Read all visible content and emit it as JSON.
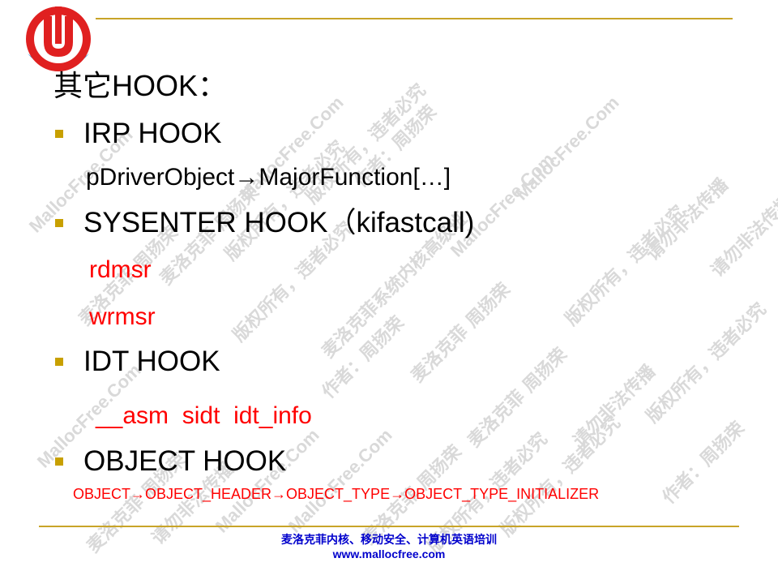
{
  "slide": {
    "heading": "其它HOOK：",
    "items": [
      {
        "kind": "bullet",
        "text": "IRP HOOK"
      },
      {
        "kind": "sub",
        "text": "pDriverObject→MajorFunction[…]"
      },
      {
        "kind": "bullet",
        "text": "SYSENTER HOOK（kifastcall)"
      },
      {
        "kind": "sub-red",
        "text": "rdmsr"
      },
      {
        "kind": "sub-red",
        "text": "wrmsr"
      },
      {
        "kind": "bullet",
        "text": "IDT HOOK"
      },
      {
        "kind": "sub-red",
        "text": "__asm  sidt  idt_info"
      },
      {
        "kind": "bullet",
        "text": "OBJECT HOOK"
      },
      {
        "kind": "small-red",
        "text": "OBJECT→OBJECT_HEADER→OBJECT_TYPE→OBJECT_TYPE_INITIALIZER"
      }
    ],
    "footer_line1": "麦洛克菲内核、移动安全、计算机英语培训",
    "footer_line2": "www.mallocfree.com"
  },
  "watermark": {
    "phrase_1": "MallocFree.Com",
    "phrase_2": "麦洛克菲 周扬荣",
    "phrase_3": "版权所有，违者必究",
    "phrase_4": "请勿非法传播",
    "phrase_5": "作者：周扬荣",
    "phrase_6": "麦洛克菲系统内核高级班"
  },
  "colors": {
    "accent_gold": "#c8a428",
    "bullet": "#c8a000",
    "red_text": "#ff0000",
    "footer_blue": "#0000cc",
    "logo_red": "#e02020",
    "logo_blue": "#3a8fd8"
  },
  "logo": {
    "icon": "mallocfree-logo-icon"
  }
}
